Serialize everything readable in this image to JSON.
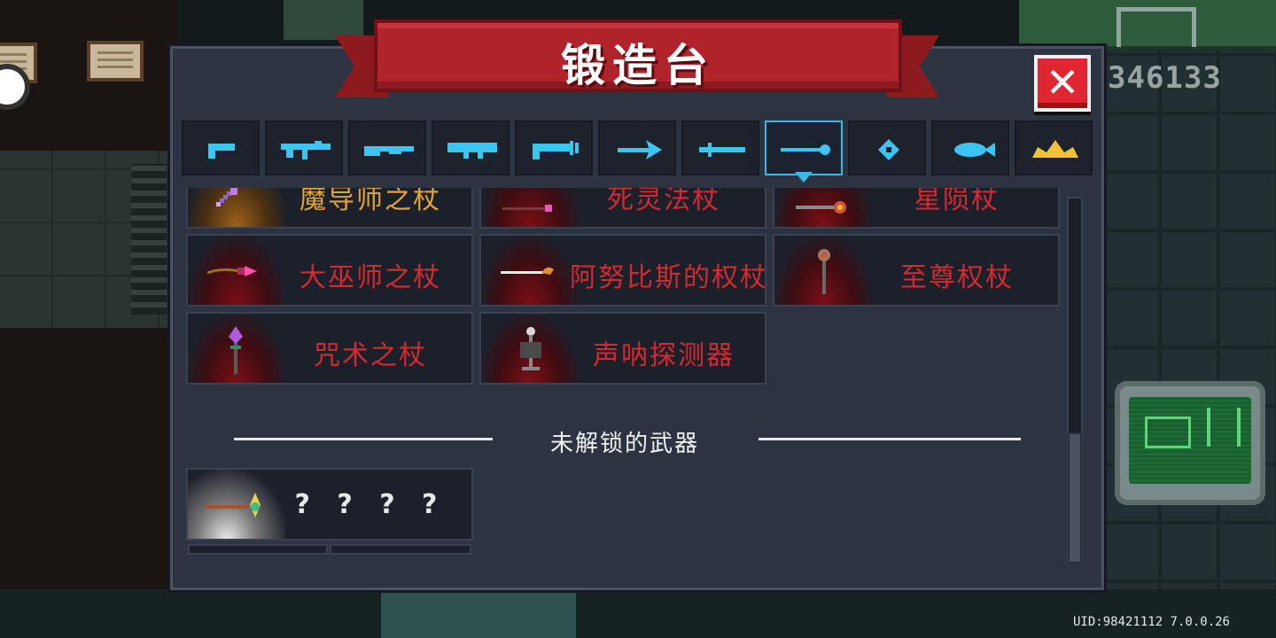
{
  "title": "锻造台",
  "close_label": "✕",
  "score": "346133",
  "uid_text": "UID:98421112 7.0.0.26",
  "tabs": [
    {
      "icon": "pistol-icon"
    },
    {
      "icon": "rifle-icon"
    },
    {
      "icon": "shotgun-icon"
    },
    {
      "icon": "launcher-icon"
    },
    {
      "icon": "laser-gun-icon"
    },
    {
      "icon": "bow-icon"
    },
    {
      "icon": "sword-icon"
    },
    {
      "icon": "staff-icon",
      "active": true
    },
    {
      "icon": "shuriken-icon"
    },
    {
      "icon": "fish-icon"
    },
    {
      "icon": "crown-icon"
    }
  ],
  "weapons": [
    {
      "name": "魔导师之杖",
      "rarity": "gold",
      "icon": "mage-staff-icon"
    },
    {
      "name": "死灵法杖",
      "rarity": "red",
      "icon": "necro-staff-icon"
    },
    {
      "name": "星陨杖",
      "rarity": "red",
      "icon": "meteor-staff-icon"
    },
    {
      "name": "大巫师之杖",
      "rarity": "red",
      "icon": "archmage-staff-icon"
    },
    {
      "name": "阿努比斯的权杖",
      "rarity": "red",
      "icon": "anubis-scepter-icon"
    },
    {
      "name": "至尊权杖",
      "rarity": "red",
      "icon": "supreme-scepter-icon"
    },
    {
      "name": "咒术之杖",
      "rarity": "red",
      "icon": "curse-staff-icon"
    },
    {
      "name": "声呐探测器",
      "rarity": "red",
      "icon": "sonar-detector-icon"
    }
  ],
  "locked_section_title": "未解锁的武器",
  "locked_weapons": [
    {
      "name": "? ? ? ?",
      "icon": "unknown-staff-icon"
    }
  ],
  "colors": {
    "accent_blue": "#3fb6e8",
    "ribbon_red": "#b0232a",
    "weapon_name_red": "#d42a2f",
    "weapon_name_gold": "#e2a43a"
  }
}
